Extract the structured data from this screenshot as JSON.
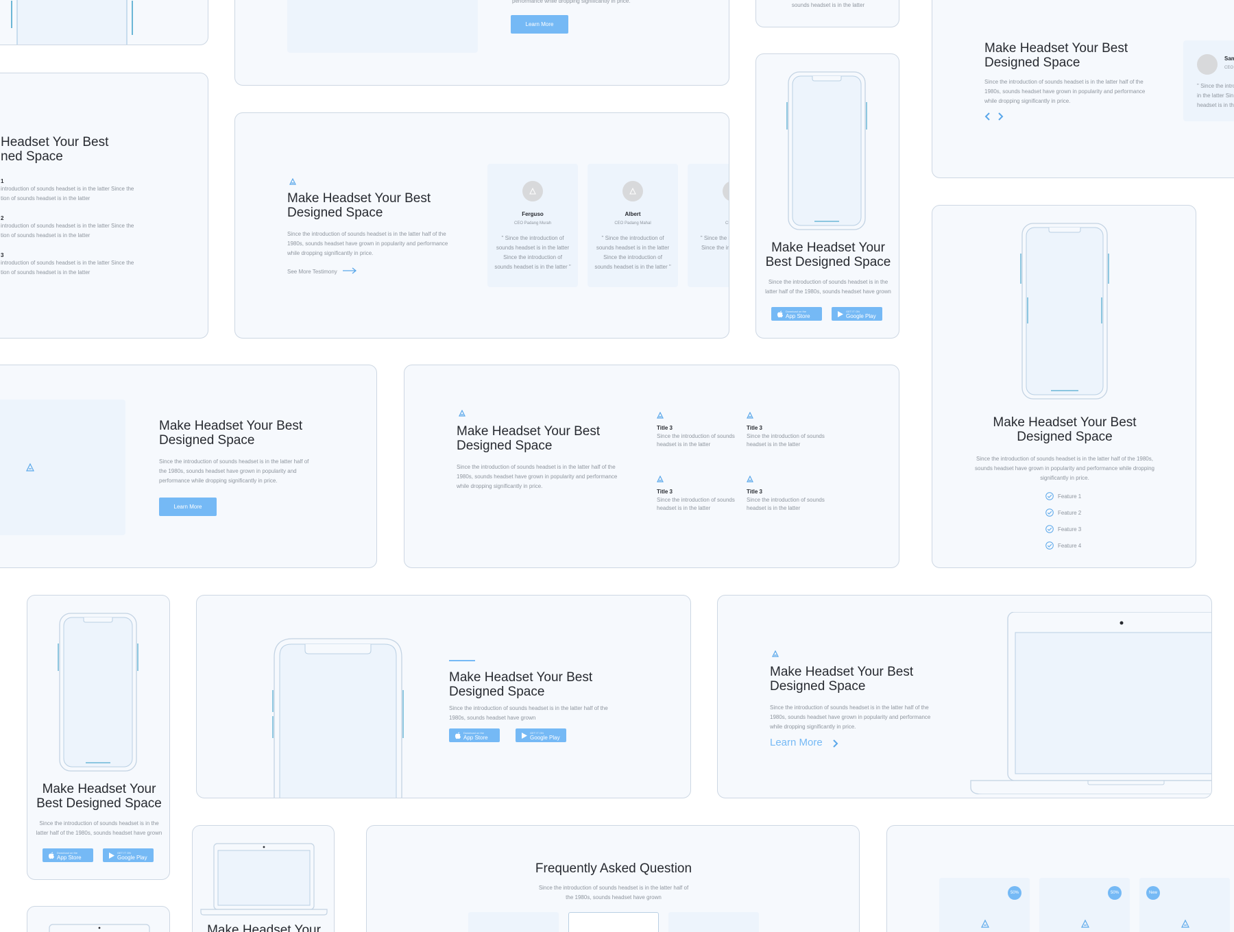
{
  "common": {
    "heading": "Make Headset Your Best Designed Space",
    "heading_line1": "Make Headset Your Best",
    "heading_line2": "Designed Space",
    "heading_alt1": "Make Headset Your",
    "heading_alt2": "Best Designed Space",
    "para_long": "Since the introduction of sounds headset is in the latter half of the 1980s, sounds headset have grown in popularity and performance while dropping significantly in price.",
    "para_short": "Since the introduction of sounds headset is in the latter half of the 1980s, sounds headset have grown",
    "learn_more": "Learn More",
    "app_store_small": "Download on the",
    "app_store": "App Store",
    "google_play_small": "GET IT ON",
    "google_play": "Google Play"
  },
  "top_strip": {
    "para_fragment": "performance while dropping significantly in price.",
    "button": "Learn More",
    "small_text": "sounds headset is in the latter"
  },
  "left_list_card": {
    "heading1": "Headset Your Best",
    "heading2": "ned Space",
    "items": [
      {
        "num": "1",
        "line1": "introduction of sounds headset is in the latter Since the",
        "line2": "tion of sounds headset is in the latter"
      },
      {
        "num": "2",
        "line1": "introduction of sounds headset is in the latter Since the",
        "line2": "tion of sounds headset is in the latter"
      },
      {
        "num": "3",
        "line1": "introduction of sounds headset is in the latter Since the",
        "line2": "tion of sounds headset is in the latter"
      }
    ]
  },
  "testimony_card": {
    "link": "See More Testimony",
    "people": [
      {
        "name": "Ferguso",
        "role": "CEO Padang Murah",
        "quote": "\" Since the introduction of sounds headset is in the latter Since the introduction of sounds headset is in the latter \""
      },
      {
        "name": "Albert",
        "role": "CEO Padang Mahal",
        "quote": "\" Since the introduction of sounds headset is in the latter Since the introduction of sounds headset is in the latter \""
      },
      {
        "name": "A",
        "role": "CEO Pa",
        "quote": "\" Since the i sounds heads Since the ir sounds heads"
      }
    ]
  },
  "top_right_card": {
    "name_fragment": "Sam",
    "role_fragment": "CEO",
    "quote_fragment1": "\" Since the intro",
    "quote_fragment2": "in the latter Sin",
    "quote_fragment3": "headset is in th"
  },
  "features_grid": {
    "items": [
      {
        "title": "Title 3",
        "text": "Since the introduction of sounds headset is in the latter"
      },
      {
        "title": "Title 3",
        "text": "Since the introduction of sounds headset is in the latter"
      },
      {
        "title": "Title 3",
        "text": "Since the introduction of sounds headset is in the latter"
      },
      {
        "title": "Title 3",
        "text": "Since the introduction of sounds headset is in the latter"
      }
    ]
  },
  "feature_list": [
    "Feature 1",
    "Feature 2",
    "Feature 3",
    "Feature 4"
  ],
  "faq": {
    "title": "Frequently Asked Question",
    "text": "Since the introduction of sounds headset is in the latter half of the 1980s, sounds headset have grown"
  },
  "pricing_badges": [
    "50%",
    "50%",
    "New"
  ],
  "colors": {
    "accent": "#75b9f5",
    "card_bg": "#f6f9fd",
    "placeholder": "#edf4fc",
    "border": "#cdd7e3",
    "icon": "#5aa7ea"
  }
}
